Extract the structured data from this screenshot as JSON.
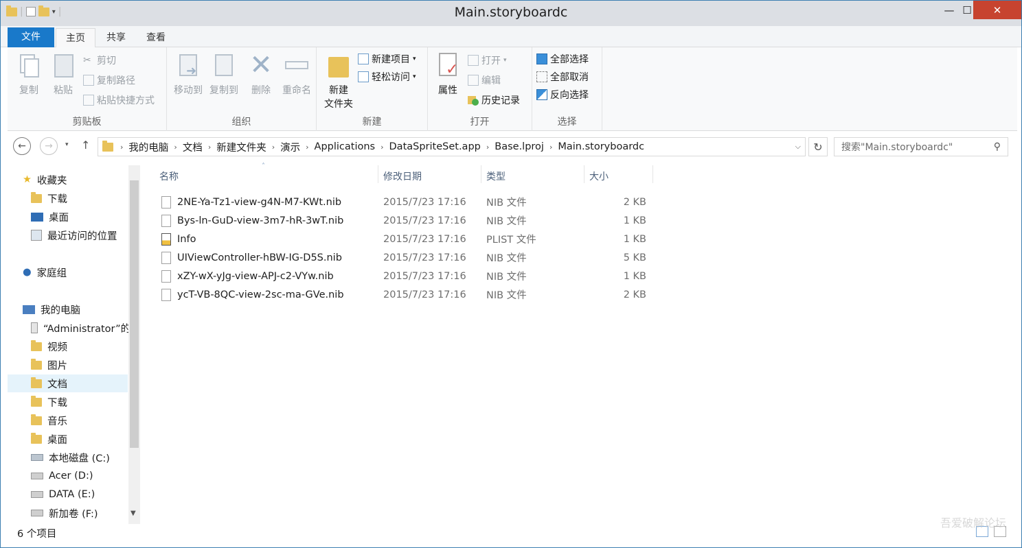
{
  "window": {
    "title": "Main.storyboardc",
    "min": "—",
    "max": "☐",
    "close": "✕"
  },
  "tabs": [
    {
      "label": "文件"
    },
    {
      "label": "主页"
    },
    {
      "label": "共享"
    },
    {
      "label": "查看"
    }
  ],
  "help": "?",
  "ribbon": {
    "clipboard": {
      "label": "剪贴板",
      "copy": "复制",
      "paste": "粘贴",
      "cut": "剪切",
      "copy_path": "复制路径",
      "paste_shortcut": "粘贴快捷方式"
    },
    "organize": {
      "label": "组织",
      "move_to": "移动到",
      "copy_to": "复制到",
      "delete": "删除",
      "rename": "重命名"
    },
    "new": {
      "label": "新建",
      "new_folder_1": "新建",
      "new_folder_2": "文件夹",
      "new_item": "新建项目",
      "easy_access": "轻松访问"
    },
    "open": {
      "label": "打开",
      "properties": "属性",
      "open": "打开",
      "edit": "编辑",
      "history": "历史记录"
    },
    "select": {
      "label": "选择",
      "select_all": "全部选择",
      "select_none": "全部取消",
      "invert": "反向选择"
    }
  },
  "address": {
    "crumbs": [
      "我的电脑",
      "文档",
      "新建文件夹",
      "演示",
      "Applications",
      "DataSpriteSet.app",
      "Base.lproj",
      "Main.storyboardc"
    ],
    "search_placeholder": "搜索\"Main.storyboardc\""
  },
  "nav": {
    "favorites": "收藏夹",
    "fav_items": [
      "下载",
      "桌面",
      "最近访问的位置"
    ],
    "homegroup": "家庭组",
    "computer": "我的电脑",
    "computer_items": [
      "“Administrator”的",
      "视频",
      "图片",
      "文档",
      "下载",
      "音乐",
      "桌面",
      "本地磁盘 (C:)",
      "Acer (D:)",
      "DATA (E:)",
      "新加卷 (F:)"
    ]
  },
  "columns": {
    "name": "名称",
    "date": "修改日期",
    "type": "类型",
    "size": "大小"
  },
  "files": [
    {
      "name": "2NE-Ya-Tz1-view-g4N-M7-KWt.nib",
      "date": "2015/7/23 17:16",
      "type": "NIB 文件",
      "size": "2 KB"
    },
    {
      "name": "Bys-ln-GuD-view-3m7-hR-3wT.nib",
      "date": "2015/7/23 17:16",
      "type": "NIB 文件",
      "size": "1 KB"
    },
    {
      "name": "Info",
      "date": "2015/7/23 17:16",
      "type": "PLIST 文件",
      "size": "1 KB"
    },
    {
      "name": "UIViewController-hBW-IG-D5S.nib",
      "date": "2015/7/23 17:16",
      "type": "NIB 文件",
      "size": "5 KB"
    },
    {
      "name": "xZY-wX-yJg-view-APJ-c2-VYw.nib",
      "date": "2015/7/23 17:16",
      "type": "NIB 文件",
      "size": "1 KB"
    },
    {
      "name": "ycT-VB-8QC-view-2sc-ma-GVe.nib",
      "date": "2015/7/23 17:16",
      "type": "NIB 文件",
      "size": "2 KB"
    }
  ],
  "status": "6 个项目",
  "watermark": "吾爱破解论坛"
}
